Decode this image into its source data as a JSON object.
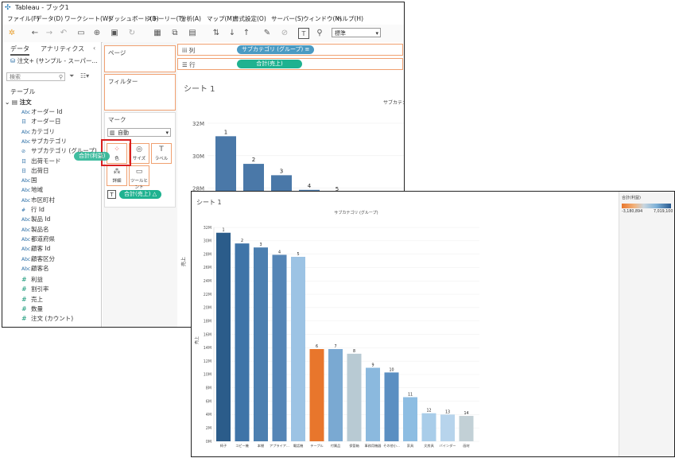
{
  "app": {
    "title": "Tableau - ブック1"
  },
  "menu": [
    "ファイル(F)",
    "データ(D)",
    "ワークシート(W)",
    "ダッシュボード(B)",
    "ストーリー(T)",
    "分析(A)",
    "マップ(M)",
    "書式設定(O)",
    "サーバー(S)",
    "ウィンドウ(N)",
    "ヘルプ(H)"
  ],
  "toolbar": {
    "fit_select": "標準"
  },
  "data_pane": {
    "tab_data": "データ",
    "tab_analytics": "アナリティクス",
    "datasource": "注文+ (サンプル - スーパー...",
    "search_placeholder": "検索",
    "tables_label": "テーブル",
    "table_name": "注文",
    "dimensions": [
      {
        "icon": "Abc",
        "name": "オーダー Id"
      },
      {
        "icon": "日",
        "name": "オーダー日"
      },
      {
        "icon": "Abc",
        "name": "カテゴリ"
      },
      {
        "icon": "Abc",
        "name": "サブカテゴリ"
      },
      {
        "icon": "⊘",
        "name": "サブカテゴリ (グループ)"
      },
      {
        "icon": "日",
        "name": "出荷モード"
      },
      {
        "icon": "日",
        "name": "出荷日"
      },
      {
        "icon": "Abc",
        "name": "国"
      },
      {
        "icon": "Abc",
        "name": "地域"
      },
      {
        "icon": "Abc",
        "name": "市区町村"
      },
      {
        "icon": "#",
        "name": "行 Id"
      },
      {
        "icon": "Abc",
        "name": "製品 Id"
      },
      {
        "icon": "Abc",
        "name": "製品名"
      },
      {
        "icon": "Abc",
        "name": "都道府県"
      },
      {
        "icon": "Abc",
        "name": "顧客 Id"
      },
      {
        "icon": "Abc",
        "name": "顧客区分"
      },
      {
        "icon": "Abc",
        "name": "顧客名"
      }
    ],
    "measures": [
      {
        "icon": "#",
        "name": "利益"
      },
      {
        "icon": "#",
        "name": "割引率"
      },
      {
        "icon": "#",
        "name": "売上"
      },
      {
        "icon": "#",
        "name": "数量"
      },
      {
        "icon": "#",
        "name": "注文 (カウント)"
      }
    ]
  },
  "shelves": {
    "pages": "ページ",
    "filters": "フィルター",
    "marks": "マーク",
    "mark_type": "自動",
    "color_btn": "色",
    "size_btn": "サイズ",
    "label_btn": "ラベル",
    "detail_btn": "詳細",
    "tooltip_btn": "ツールヒント",
    "drag_pill": "合計(利益)",
    "sales_pill": "合計(売上)",
    "columns_label": "列",
    "rows_label": "行",
    "columns_pill": "サブカテゴリ (グループ)",
    "rows_pill": "合計(売上)"
  },
  "back_sheet": {
    "title": "シート 1",
    "header": "サブカテゴリ",
    "y_label": "売上",
    "yticks": [
      "32M",
      "30M",
      "28M",
      "26M"
    ],
    "bar_labels": [
      "1",
      "2",
      "3",
      "4",
      "5"
    ],
    "values": [
      31.2,
      29.5,
      28.8,
      27.9,
      27.7
    ],
    "color": "#4a78a8"
  },
  "front_sheet": {
    "title": "シート 1",
    "legend_title": "合計(利益)",
    "legend_min": "-3,180,894",
    "legend_max": "7,019,100",
    "colors": {
      "dark": "#2b5c8a",
      "mid": "#4a7eb5",
      "light": "#9cc3e4",
      "orange": "#e8762c",
      "gray": "#b8cad3",
      "pale": "#c9dbe8"
    }
  },
  "chart_data": {
    "type": "bar",
    "title": "シート 1",
    "header": "サブカテゴリ (グループ)",
    "xlabel": "",
    "ylabel": "売上",
    "ylim": [
      0,
      32
    ],
    "yticks": [
      "0M",
      "2M",
      "4M",
      "6M",
      "8M",
      "10M",
      "12M",
      "14M",
      "16M",
      "18M",
      "20M",
      "22M",
      "24M",
      "26M",
      "28M",
      "30M",
      "32M"
    ],
    "categories": [
      "椅子",
      "コピー機",
      "本棚",
      "アプライア...",
      "電話機",
      "テーブル",
      "付属品",
      "保管箱",
      "事務用機器",
      "その他小...",
      "家具",
      "文房具",
      "バインダー",
      "画材"
    ],
    "values": [
      31.2,
      29.6,
      29.0,
      27.9,
      27.6,
      13.8,
      13.8,
      13.1,
      11.0,
      10.3,
      6.6,
      4.2,
      4.0,
      3.8
    ],
    "rank_labels": [
      "1",
      "2",
      "3",
      "4",
      "5",
      "6",
      "7",
      "8",
      "9",
      "10",
      "11",
      "12",
      "13",
      "14"
    ],
    "bar_colors": [
      "#2b5c8a",
      "#3f74a8",
      "#4c7fb0",
      "#5585b6",
      "#9cc3e4",
      "#e8762c",
      "#7aa9d2",
      "#b8cad3",
      "#8bb9de",
      "#5b8fc2",
      "#8dbde2",
      "#a9cde9",
      "#b7d4ec",
      "#c2d0d6"
    ],
    "legend": {
      "title": "合計(利益)",
      "min": "-3,180,894",
      "max": "7,019,100"
    }
  }
}
